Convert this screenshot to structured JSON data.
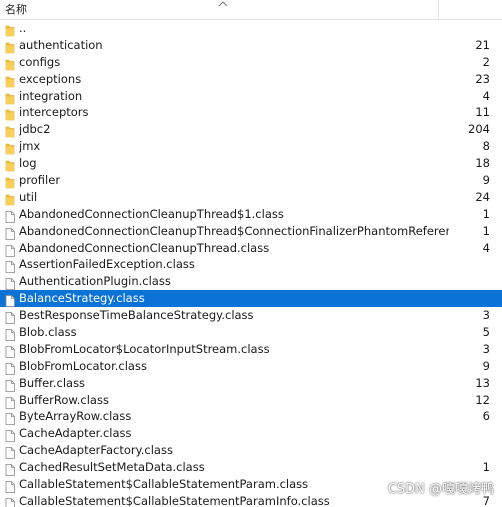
{
  "header": {
    "name_label": "名称"
  },
  "rows": [
    {
      "type": "folder",
      "name": "..",
      "count": ""
    },
    {
      "type": "folder",
      "name": "authentication",
      "count": "21"
    },
    {
      "type": "folder",
      "name": "configs",
      "count": "2"
    },
    {
      "type": "folder",
      "name": "exceptions",
      "count": "23"
    },
    {
      "type": "folder",
      "name": "integration",
      "count": "4"
    },
    {
      "type": "folder",
      "name": "interceptors",
      "count": "11"
    },
    {
      "type": "folder",
      "name": "jdbc2",
      "count": "204"
    },
    {
      "type": "folder",
      "name": "jmx",
      "count": "8"
    },
    {
      "type": "folder",
      "name": "log",
      "count": "18"
    },
    {
      "type": "folder",
      "name": "profiler",
      "count": "9"
    },
    {
      "type": "folder",
      "name": "util",
      "count": "24"
    },
    {
      "type": "file",
      "name": "AbandonedConnectionCleanupThread$1.class",
      "count": "1"
    },
    {
      "type": "file",
      "name": "AbandonedConnectionCleanupThread$ConnectionFinalizerPhantomReference.cla...",
      "count": "1"
    },
    {
      "type": "file",
      "name": "AbandonedConnectionCleanupThread.class",
      "count": "4"
    },
    {
      "type": "file",
      "name": "AssertionFailedException.class",
      "count": ""
    },
    {
      "type": "file",
      "name": "AuthenticationPlugin.class",
      "count": ""
    },
    {
      "type": "file",
      "name": "BalanceStrategy.class",
      "count": "",
      "selected": true
    },
    {
      "type": "file",
      "name": "BestResponseTimeBalanceStrategy.class",
      "count": "3"
    },
    {
      "type": "file",
      "name": "Blob.class",
      "count": "5"
    },
    {
      "type": "file",
      "name": "BlobFromLocator$LocatorInputStream.class",
      "count": "3"
    },
    {
      "type": "file",
      "name": "BlobFromLocator.class",
      "count": "9"
    },
    {
      "type": "file",
      "name": "Buffer.class",
      "count": "13"
    },
    {
      "type": "file",
      "name": "BufferRow.class",
      "count": "12"
    },
    {
      "type": "file",
      "name": "ByteArrayRow.class",
      "count": "6"
    },
    {
      "type": "file",
      "name": "CacheAdapter.class",
      "count": ""
    },
    {
      "type": "file",
      "name": "CacheAdapterFactory.class",
      "count": ""
    },
    {
      "type": "file",
      "name": "CachedResultSetMetaData.class",
      "count": "1"
    },
    {
      "type": "file",
      "name": "CallableStatement$CallableStatementParam.class",
      "count": ""
    },
    {
      "type": "file",
      "name": "CallableStatement$CallableStatementParamInfo.class",
      "count": "7"
    }
  ],
  "watermark": "CSDN @嘎嘎烤鸭",
  "colors": {
    "selection": "#0b73d6",
    "folder": "#f3c03d",
    "file_icon_border": "#8a8a8a"
  }
}
